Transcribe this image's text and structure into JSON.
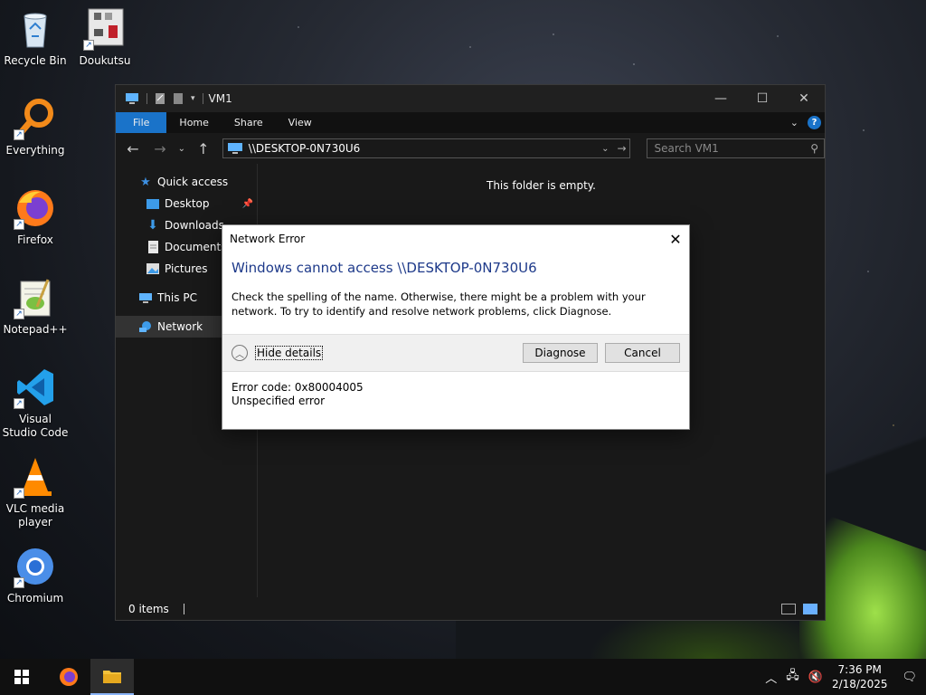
{
  "desktop": {
    "icons": [
      {
        "label": "Recycle Bin",
        "name": "recycle-bin"
      },
      {
        "label": "Doukutsu",
        "name": "doukutsu"
      },
      {
        "label": "Everything",
        "name": "everything"
      },
      {
        "label": "Firefox",
        "name": "firefox"
      },
      {
        "label": "Notepad++",
        "name": "notepad-plus-plus"
      },
      {
        "label": "Visual Studio Code",
        "name": "vscode"
      },
      {
        "label": "VLC media player",
        "name": "vlc"
      },
      {
        "label": "Chromium",
        "name": "chromium"
      }
    ]
  },
  "explorer": {
    "title": "VM1",
    "ribbon_tabs": [
      "File",
      "Home",
      "Share",
      "View"
    ],
    "address": "\\\\DESKTOP-0N730U6",
    "search_placeholder": "Search VM1",
    "nav": {
      "quick_access": "Quick access",
      "desktop": "Desktop",
      "downloads": "Downloads",
      "documents": "Documents",
      "pictures": "Pictures",
      "this_pc": "This PC",
      "network": "Network"
    },
    "empty_message": "This folder is empty.",
    "status": "0 items"
  },
  "dialog": {
    "title": "Network Error",
    "heading": "Windows cannot access \\\\DESKTOP-0N730U6",
    "message": "Check the spelling of the name. Otherwise, there might be a problem with your network. To try to identify and resolve network problems, click Diagnose.",
    "hide_details": "Hide details",
    "diagnose": "Diagnose",
    "cancel": "Cancel",
    "error_code": "Error code: 0x80004005",
    "error_text": "Unspecified error"
  },
  "taskbar": {
    "time": "7:36 PM",
    "date": "2/18/2025"
  },
  "colors": {
    "accent": "#1a73c9",
    "dialog_heading": "#1e3a8a"
  }
}
